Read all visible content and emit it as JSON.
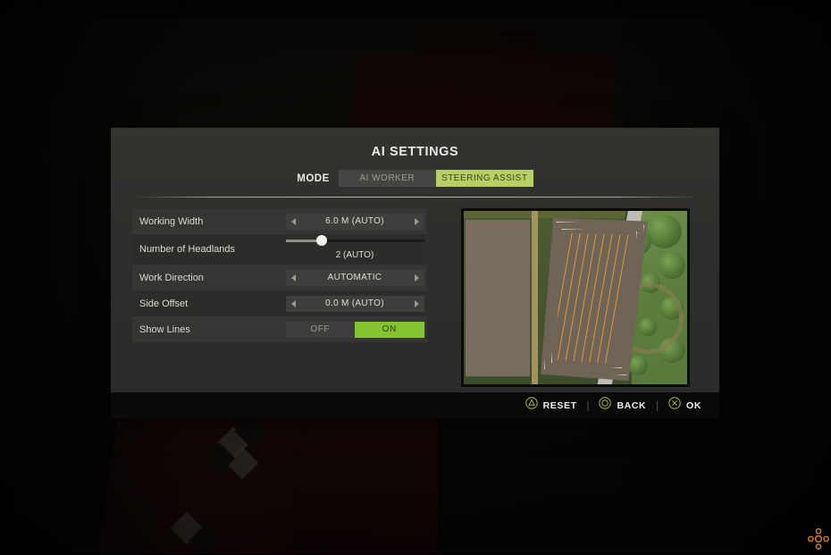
{
  "dialog": {
    "title": "AI SETTINGS",
    "mode": {
      "label": "MODE",
      "tabs": [
        {
          "label": "AI WORKER",
          "active": false
        },
        {
          "label": "STEERING ASSIST",
          "active": true
        }
      ]
    },
    "settings": [
      {
        "label": "Working Width",
        "type": "stepper",
        "value": "6.0 M (AUTO)"
      },
      {
        "label": "Number of Headlands",
        "type": "slider",
        "value": "2 (AUTO)",
        "percent": 26
      },
      {
        "label": "Work Direction",
        "type": "stepper",
        "value": "AUTOMATIC"
      },
      {
        "label": "Side Offset",
        "type": "stepper",
        "value": "0.0 M (AUTO)"
      },
      {
        "label": "Show Lines",
        "type": "toggle",
        "off_label": "OFF",
        "on_label": "ON",
        "value": "ON"
      }
    ],
    "preview": {
      "name": "field-map-preview",
      "work_lines": 10
    }
  },
  "action_bar": {
    "actions": [
      {
        "label": "RESET",
        "glyph": "triangle-button-icon"
      },
      {
        "label": "BACK",
        "glyph": "circle-button-icon"
      },
      {
        "label": "OK",
        "glyph": "cross-button-icon"
      }
    ],
    "separator": "|"
  },
  "colors": {
    "accent_active_tab": "#b8cf63",
    "accent_toggle_on": "#83c531",
    "glyph_ring": "#9aa84e",
    "work_line": "#d99a3f",
    "dialog_bg": "#2e2e2c",
    "action_bar_bg": "#090909"
  },
  "cursor": {
    "name": "move-cursor",
    "color": "#c4762a"
  }
}
